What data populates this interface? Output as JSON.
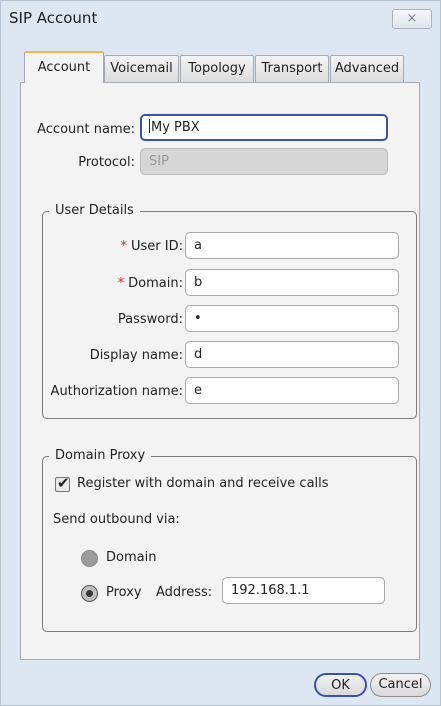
{
  "window": {
    "title": "SIP Account",
    "close_icon": "×"
  },
  "tabs": [
    {
      "label": "Account",
      "active": true
    },
    {
      "label": "Voicemail"
    },
    {
      "label": "Topology"
    },
    {
      "label": "Transport"
    },
    {
      "label": "Advanced"
    }
  ],
  "account": {
    "name_label": "Account name:",
    "name_value": "My PBX",
    "protocol_label": "Protocol:",
    "protocol_value": "SIP"
  },
  "user_details": {
    "legend": "User Details",
    "required_marker": "*",
    "user_id_label": "User ID:",
    "user_id_value": "a",
    "domain_label": "Domain:",
    "domain_value": "b",
    "password_label": "Password:",
    "password_value": "•",
    "display_name_label": "Display name:",
    "display_name_value": "d",
    "auth_name_label": "Authorization name:",
    "auth_name_value": "e"
  },
  "domain_proxy": {
    "legend": "Domain Proxy",
    "register_label": "Register with domain and receive calls",
    "register_checked": true,
    "send_via_label": "Send outbound via:",
    "domain_option": "Domain",
    "proxy_option": "Proxy",
    "selected": "Proxy",
    "address_label": "Address:",
    "address_value": "192.168.1.1"
  },
  "buttons": {
    "ok": "OK",
    "cancel": "Cancel"
  },
  "colors": {
    "focus_border": "#3651b8",
    "required": "#d22a2a",
    "active_tab_accent": "#f0b84a"
  }
}
